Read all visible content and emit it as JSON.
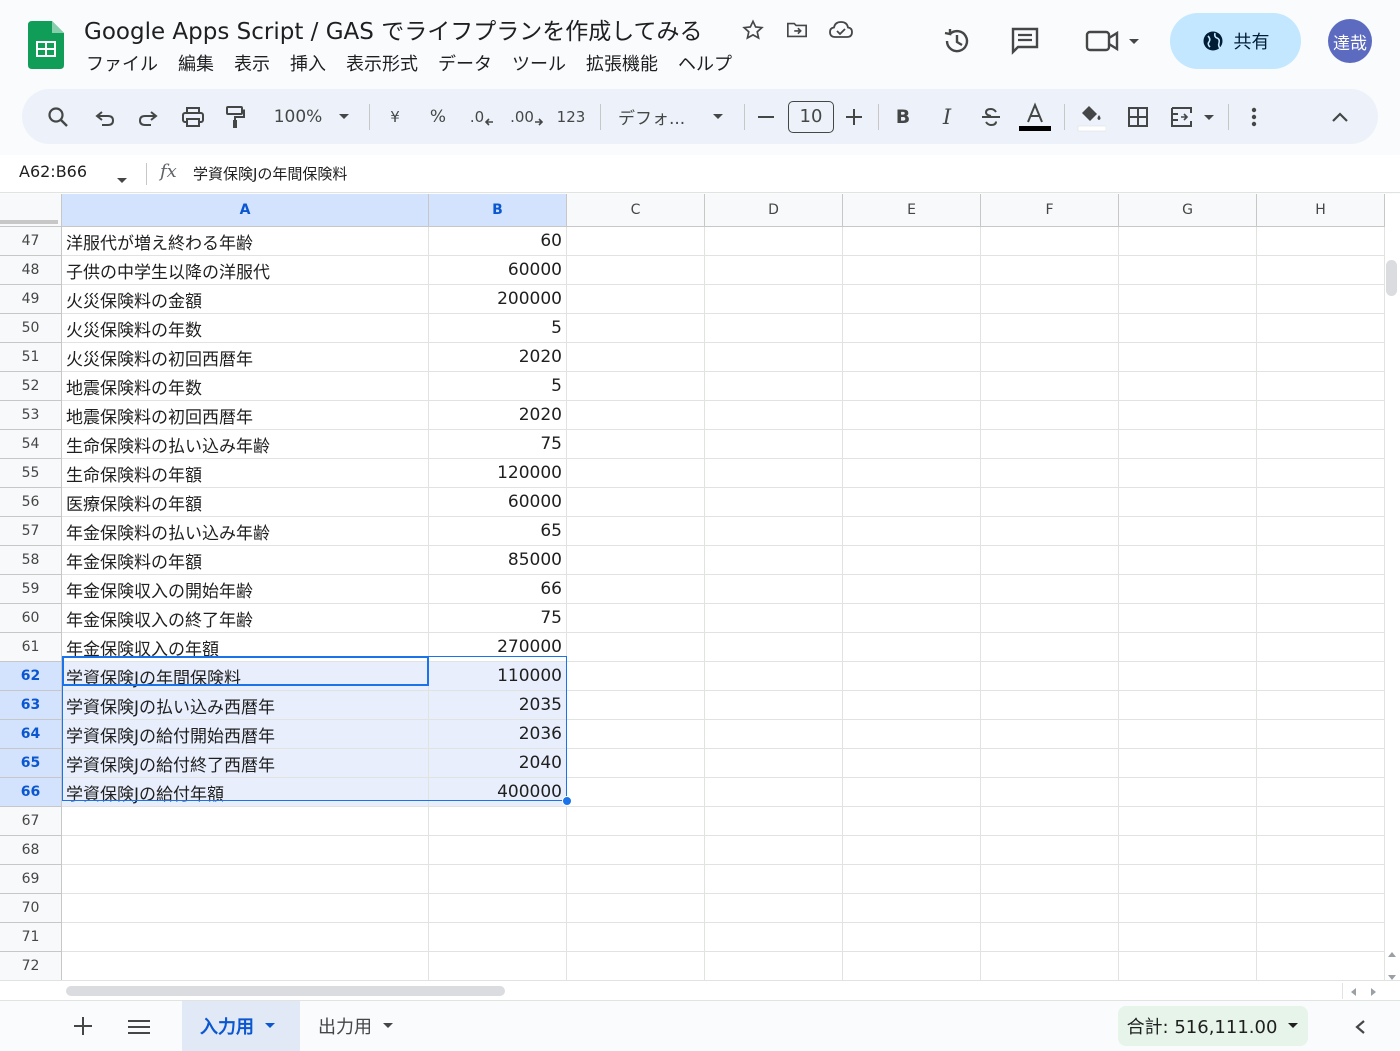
{
  "header": {
    "title": "Google Apps Script / GAS でライフプランを作成してみる",
    "share_label": "共有",
    "avatar_text": "達哉"
  },
  "menu": [
    "ファイル",
    "編集",
    "表示",
    "挿入",
    "表示形式",
    "データ",
    "ツール",
    "拡張機能",
    "ヘルプ"
  ],
  "toolbar": {
    "zoom": "100%",
    "currency": "¥",
    "percent": "%",
    "dec_decrease": ".0",
    "dec_increase": ".00",
    "number_format": "123",
    "font": "デフォ...",
    "font_size": "10",
    "bold": "B",
    "italic": "I"
  },
  "formula_bar": {
    "name_box": "A62:B66",
    "fx": "fx",
    "content": "学資保険Jの年間保険料"
  },
  "columns": [
    "A",
    "B",
    "C",
    "D",
    "E",
    "F",
    "G",
    "H"
  ],
  "rows": [
    {
      "num": "47",
      "a": "洋服代が増え終わる年齢",
      "b": "60"
    },
    {
      "num": "48",
      "a": "子供の中学生以降の洋服代",
      "b": "60000"
    },
    {
      "num": "49",
      "a": "火災保険料の金額",
      "b": "200000"
    },
    {
      "num": "50",
      "a": "火災保険料の年数",
      "b": "5"
    },
    {
      "num": "51",
      "a": "火災保険料の初回西暦年",
      "b": "2020"
    },
    {
      "num": "52",
      "a": "地震保険料の年数",
      "b": "5"
    },
    {
      "num": "53",
      "a": "地震保険料の初回西暦年",
      "b": "2020"
    },
    {
      "num": "54",
      "a": "生命保険料の払い込み年齢",
      "b": "75"
    },
    {
      "num": "55",
      "a": "生命保険料の年額",
      "b": "120000"
    },
    {
      "num": "56",
      "a": "医療保険料の年額",
      "b": "60000"
    },
    {
      "num": "57",
      "a": "年金保険料の払い込み年齢",
      "b": "65"
    },
    {
      "num": "58",
      "a": "年金保険料の年額",
      "b": "85000"
    },
    {
      "num": "59",
      "a": "年金保険収入の開始年齢",
      "b": "66"
    },
    {
      "num": "60",
      "a": "年金保険収入の終了年齢",
      "b": "75"
    },
    {
      "num": "61",
      "a": "年金保険収入の年額",
      "b": "270000"
    },
    {
      "num": "62",
      "a": "学資保険Jの年間保険料",
      "b": "110000"
    },
    {
      "num": "63",
      "a": "学資保険Jの払い込み西暦年",
      "b": "2035"
    },
    {
      "num": "64",
      "a": "学資保険Jの給付開始西暦年",
      "b": "2036"
    },
    {
      "num": "65",
      "a": "学資保険Jの給付終了西暦年",
      "b": "2040"
    },
    {
      "num": "66",
      "a": "学資保険Jの給付年額",
      "b": "400000"
    },
    {
      "num": "67",
      "a": "",
      "b": ""
    },
    {
      "num": "68",
      "a": "",
      "b": ""
    },
    {
      "num": "69",
      "a": "",
      "b": ""
    },
    {
      "num": "70",
      "a": "",
      "b": ""
    },
    {
      "num": "71",
      "a": "",
      "b": ""
    },
    {
      "num": "72",
      "a": "",
      "b": ""
    }
  ],
  "selected_rows": [
    "62",
    "63",
    "64",
    "65",
    "66"
  ],
  "sheets": [
    {
      "label": "入力用",
      "active": true
    },
    {
      "label": "出力用",
      "active": false
    }
  ],
  "sum_label": "合計: 516,111.00",
  "colors": {
    "accent": "#1a73e8",
    "share_bg": "#c2e7ff",
    "sheets_green": "#0f9d58",
    "selection_bg": "#e8eefc"
  }
}
